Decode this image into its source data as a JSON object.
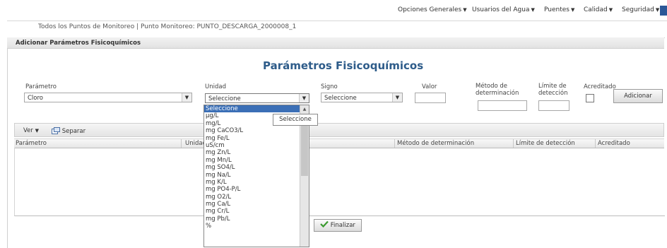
{
  "topnav": {
    "items": [
      {
        "label": "Opciones Generales"
      },
      {
        "label": "Usuarios del Agua"
      },
      {
        "label": "Puentes"
      },
      {
        "label": "Calidad"
      },
      {
        "label": "Seguridad"
      }
    ]
  },
  "breadcrumb": "Todos los Puntos de Monitoreo | Punto Monitoreo: PUNTO_DESCARGA_2000008_1",
  "panel": {
    "title": "Adicionar Parámetros Fisicoquímicos"
  },
  "form": {
    "title": "Parámetros Fisicoquímicos",
    "parametro": {
      "label": "Parámetro",
      "value": "Cloro"
    },
    "unidad": {
      "label": "Unidad",
      "value": "Seleccione"
    },
    "signo": {
      "label": "Signo",
      "value": "Seleccione"
    },
    "valor": {
      "label": "Valor"
    },
    "metodo": {
      "label": "Método de determinación"
    },
    "limite": {
      "label": "Límite de detección"
    },
    "acreditado": {
      "label": "Acreditado"
    },
    "adicionar": "Adicionar"
  },
  "toolbar": {
    "ver": "Ver",
    "separar": "Separar"
  },
  "grid": {
    "columns": [
      "Parámetro",
      "Unidad",
      "Método de determinación",
      "Límite de detección",
      "Acreditado"
    ]
  },
  "dropdown": {
    "options": [
      "Seleccione",
      "µg/L",
      "mg/L",
      "mg CaCO3/L",
      "mg Fe/L",
      "uS/cm",
      "mg Zn/L",
      "mg Mn/L",
      "mg SO4/L",
      "mg Na/L",
      "mg K/L",
      "mg PO4-P/L",
      "mg O2/L",
      "mg Ca/L",
      "mg Cr/L",
      "mg Pb/L",
      "%"
    ]
  },
  "tooltip": "Seleccione",
  "finalizar": "Finalizar",
  "colors": {
    "title": "#2e5c8a",
    "selected": "#3b6fb6",
    "finalizar_icon": "#3a9a2e"
  }
}
